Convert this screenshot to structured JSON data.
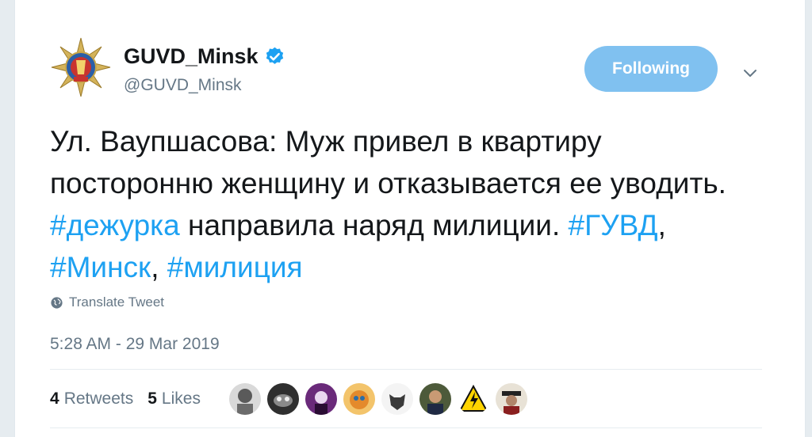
{
  "user": {
    "display_name": "GUVD_Minsk",
    "handle": "@GUVD_Minsk"
  },
  "follow_button": {
    "label": "Following"
  },
  "tweet": {
    "segments": [
      {
        "text": "Ул. Ваупшасова: Муж привел в квартиру посторонню женщину и отказывается ее уводить. ",
        "type": "text"
      },
      {
        "text": "#дежурка",
        "type": "hashtag"
      },
      {
        "text": " направила наряд милиции. ",
        "type": "text"
      },
      {
        "text": "#ГУВД",
        "type": "hashtag"
      },
      {
        "text": ", ",
        "type": "text"
      },
      {
        "text": "#Минск",
        "type": "hashtag"
      },
      {
        "text": ", ",
        "type": "text"
      },
      {
        "text": "#милиция",
        "type": "hashtag"
      }
    ]
  },
  "translate_label": "Translate Tweet",
  "timestamp": "5:28 AM - 29 Mar 2019",
  "stats": {
    "retweets_count": "4",
    "retweets_label": "Retweets",
    "likes_count": "5",
    "likes_label": "Likes"
  },
  "colors": {
    "link": "#1da1f2",
    "follow_bg": "#80c1f0",
    "secondary_text": "#657786"
  },
  "liker_avatars": [
    "avatar-1",
    "avatar-2",
    "avatar-3",
    "avatar-4",
    "avatar-5",
    "avatar-6",
    "avatar-7",
    "avatar-8"
  ]
}
